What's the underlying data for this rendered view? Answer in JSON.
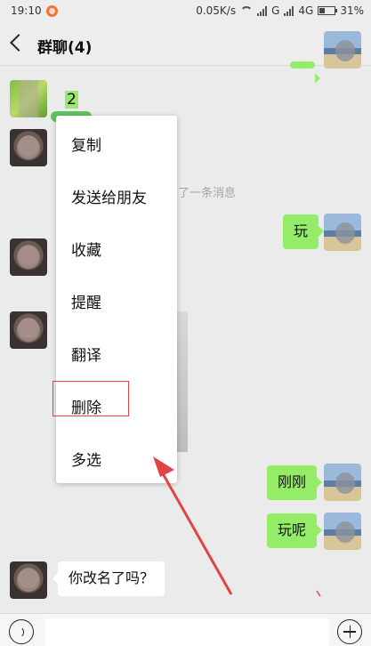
{
  "status_bar": {
    "time": "19:10",
    "network_speed": "0.05K/s",
    "carrier1": "G",
    "carrier2": "4G",
    "battery": "31%"
  },
  "header": {
    "title": "群聊(4)"
  },
  "messages": {
    "top_left_text": "2",
    "system_partial": "了一条消息",
    "right_1": "玩",
    "right_2": "刚刚",
    "right_3": "玩呢",
    "left_last": "你改名了吗？"
  },
  "context_menu": {
    "items": [
      "复制",
      "发送给朋友",
      "收藏",
      "提醒",
      "翻译",
      "删除",
      "多选"
    ],
    "highlighted": "删除"
  },
  "colors": {
    "bubble_right": "#95ec69",
    "annotation_red": "#e04545",
    "background": "#ebebeb"
  },
  "icons": [
    "back-icon",
    "more-icon",
    "voice-icon",
    "plus-icon"
  ]
}
